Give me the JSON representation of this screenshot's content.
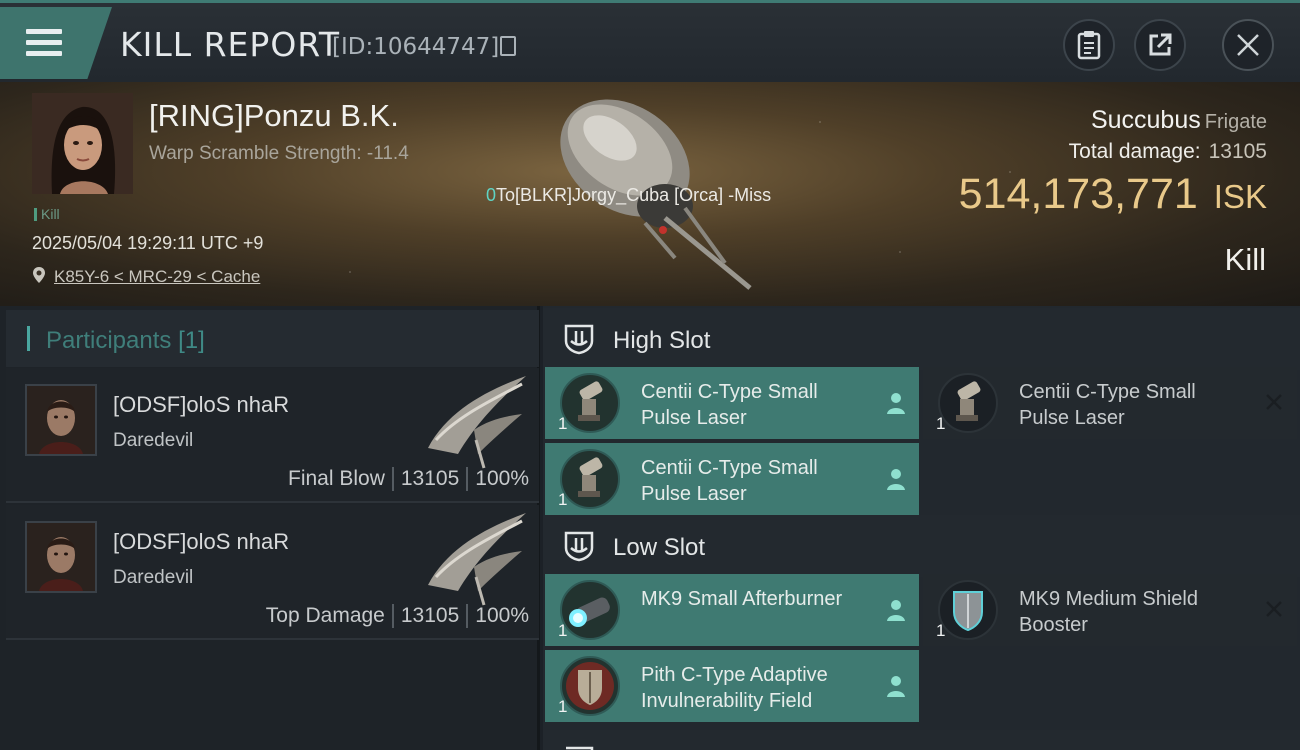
{
  "header": {
    "title": "KILL REPORT",
    "report_id": "[ID:10644747]"
  },
  "victim": {
    "name": "[RING]Ponzu B.K.",
    "warp_scramble": "Warp Scramble Strength: -11.4",
    "tag": "Kill",
    "date": "2025/05/04 19:29:11 UTC +9",
    "location": "K85Y-6 < MRC-29 < Cache",
    "attacker_count": "0",
    "attacker_note": "To[BLKR]Jorgy_Cuba [Orca] -Miss",
    "ship": "Succubus",
    "ship_class": "Frigate",
    "damage_label": "Total damage:",
    "damage_value": "13105",
    "isk_value": "514,173,771",
    "isk_unit": "ISK",
    "result": "Kill"
  },
  "participants": {
    "label": "Participants",
    "count": "[1]",
    "rows": [
      {
        "name": "[ODSF]oloS nhaR",
        "ship": "Daredevil",
        "role": "Final Blow",
        "damage": "13105",
        "percent": "100%"
      },
      {
        "name": "[ODSF]oloS nhaR",
        "ship": "Daredevil",
        "role": "Top Damage",
        "damage": "13105",
        "percent": "100%"
      }
    ]
  },
  "fitting": {
    "high_slot": "High Slot",
    "low_slot": "Low Slot",
    "modules": [
      {
        "qty": "1",
        "name": "Centii C-Type Small Pulse Laser",
        "status": "fitted"
      },
      {
        "qty": "1",
        "name": "Centii C-Type Small Pulse Laser",
        "status": "destroyed"
      },
      {
        "qty": "1",
        "name": "Centii C-Type Small Pulse Laser",
        "status": "fitted"
      },
      {
        "qty": "1",
        "name": "MK9 Small Afterburner",
        "status": "fitted"
      },
      {
        "qty": "1",
        "name": "MK9 Medium Shield Booster",
        "status": "destroyed"
      },
      {
        "qty": "1",
        "name": "Pith C-Type Adaptive Invulnerability Field",
        "status": "fitted"
      }
    ]
  },
  "colors": {
    "accent": "#3f7a72",
    "isk": "#e9c98a",
    "background": "#1c2127"
  },
  "icons": [
    "menu-icon",
    "copy-icon",
    "clipboard-icon",
    "share-icon",
    "close-icon",
    "location-pin-icon",
    "slot-shield-icon",
    "pilot-icon",
    "destroyed-x-icon"
  ]
}
